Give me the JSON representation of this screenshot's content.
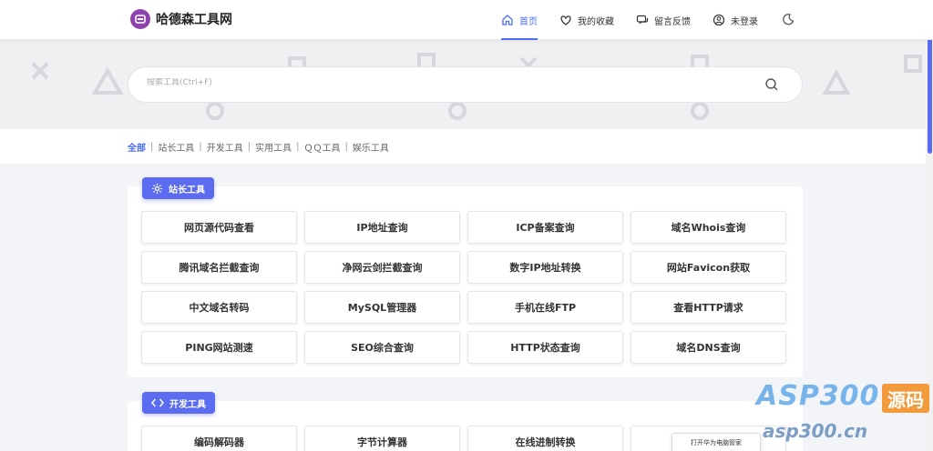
{
  "header": {
    "brand": "哈德森工具网",
    "nav": [
      {
        "label": "首页",
        "icon": "home-icon",
        "active": true
      },
      {
        "label": "我的收藏",
        "icon": "heart-icon",
        "active": false
      },
      {
        "label": "留言反馈",
        "icon": "message-icon",
        "active": false
      },
      {
        "label": "未登录",
        "icon": "user-icon",
        "active": false
      }
    ]
  },
  "search": {
    "placeholder": "搜索工具(Ctrl+F)"
  },
  "categories": [
    "全部",
    "站长工具",
    "开发工具",
    "实用工具",
    "ＱＱ工具",
    "娱乐工具"
  ],
  "sections": [
    {
      "title": "站长工具",
      "icon": "gear-icon",
      "tools": [
        "网页源代码查看",
        "IP地址查询",
        "ICP备案查询",
        "域名Whois查询",
        "腾讯域名拦截查询",
        "净网云剑拦截查询",
        "数字IP地址转换",
        "网站Favicon获取",
        "中文域名转码",
        "MySQL管理器",
        "手机在线FTP",
        "查看HTTP请求",
        "PING网站测速",
        "SEO综合查询",
        "HTTP状态查询",
        "域名DNS查询"
      ]
    },
    {
      "title": "开发工具",
      "icon": "code-icon",
      "tools": [
        "编码解码器",
        "字节计算器",
        "在线进制转换",
        ""
      ]
    }
  ],
  "watermark": {
    "line1": "ASP300",
    "badge": "源码",
    "line2": "asp300.cn"
  },
  "popup": "打开华为电脑管家",
  "colors": {
    "accent": "#4a6cf7",
    "tag": "#5b6cf0"
  }
}
